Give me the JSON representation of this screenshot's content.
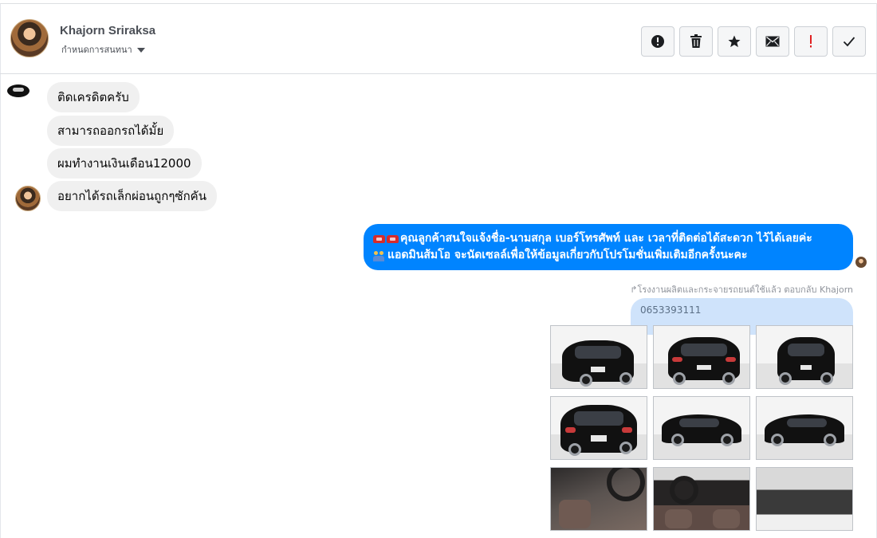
{
  "header": {
    "name": "Khajorn Sriraksa",
    "subtitle": "กำหนดการสนทนา"
  },
  "actions": [
    {
      "icon": "alert-circle-icon",
      "label": "report"
    },
    {
      "icon": "trash-icon",
      "label": "delete"
    },
    {
      "icon": "star-icon",
      "label": "star"
    },
    {
      "icon": "envelope-icon",
      "label": "mark unread"
    },
    {
      "icon": "exclamation-icon",
      "label": "important",
      "color": "#e02020"
    },
    {
      "icon": "check-icon",
      "label": "done"
    }
  ],
  "messages_in": [
    "ติดเครดิตครับ",
    "สามารถออกรถได้มั้ย",
    "ผมทำงานเงินเดือน12000",
    "อยากได้รถเล็กผ่อนถูกๆซักคัน"
  ],
  "message_out": {
    "line1": "คุณลูกค้าสนใจแจ้งชื่อ-นามสกุล เบอร์โทรศัพท์ และ เวลาที่ติดต่อได้สะดวก ไว้ได้เลยค่ะ",
    "line2": "แอดมินส้มโอ จะนัดเซลล์เพื่อให้ข้อมูลเกี่ยวกับโปรโมชั่นเพิ่มเติมอีกครั้งนะคะ",
    "color": "#0084ff"
  },
  "reply_note": "↱โรงงานผลิตและกระจายรถยนต์ใช้แล้ว ตอบกลับ Khajorn",
  "quoted_text": "0653393111",
  "photos": [
    "car-front-left",
    "car-rear-right",
    "car-front",
    "car-rear-left",
    "car-side-left",
    "car-side-right",
    "car-interior-gear",
    "car-interior-dashboard",
    "car-engine-bay"
  ]
}
